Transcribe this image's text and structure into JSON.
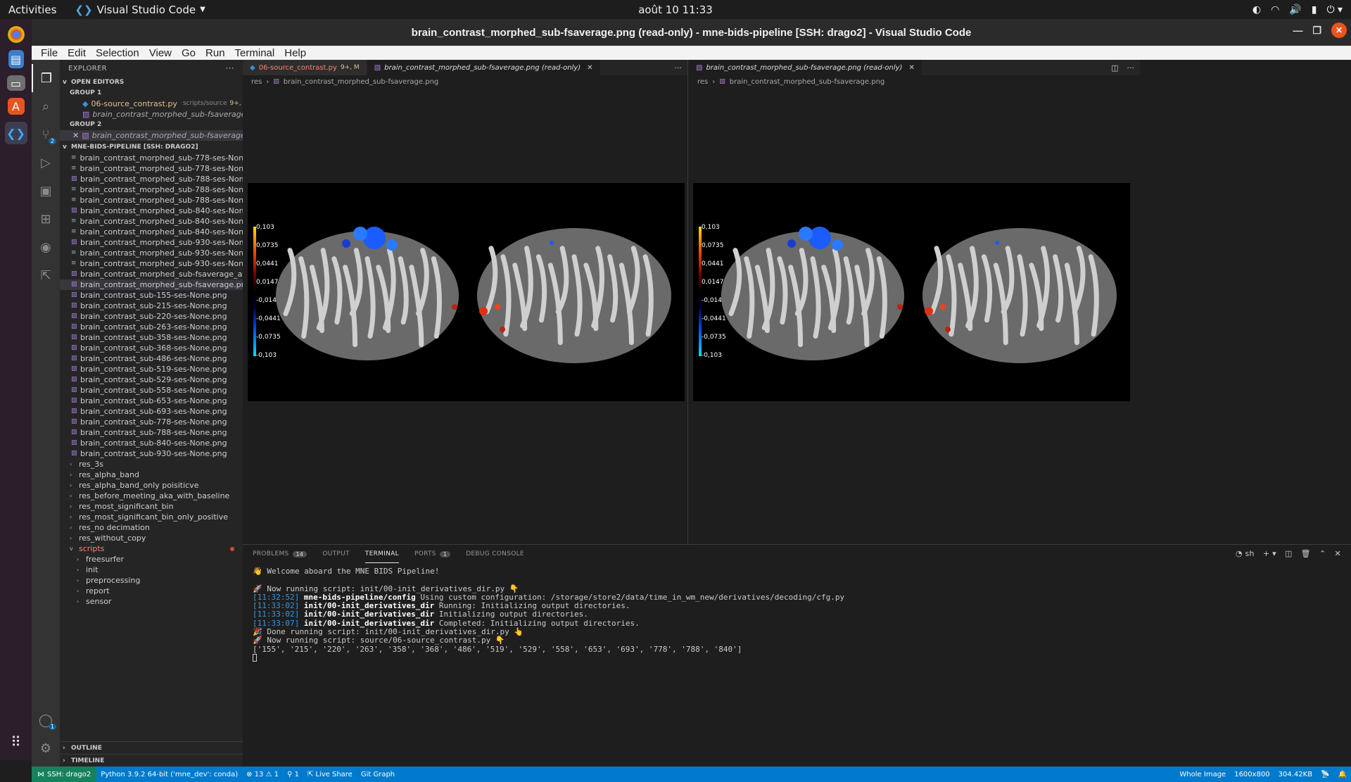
{
  "topbar": {
    "activities": "Activities",
    "app_name": "Visual Studio Code",
    "clock": "août 10  11:33"
  },
  "window": {
    "title": "brain_contrast_morphed_sub-fsaverage.png (read-only) - mne-bids-pipeline [SSH: drago2] - Visual Studio Code"
  },
  "menubar": [
    "File",
    "Edit",
    "Selection",
    "View",
    "Go",
    "Run",
    "Terminal",
    "Help"
  ],
  "activitybar": {
    "scm_badge": "2",
    "accounts_badge": "1"
  },
  "explorer": {
    "title": "EXPLORER",
    "open_editors_label": "OPEN EDITORS",
    "group1_label": "GROUP 1",
    "group1_items": [
      {
        "name": "06-source_contrast.py",
        "desc": "scripts/source",
        "flag": "9+, M"
      },
      {
        "name": "brain_contrast_morphed_sub-fsaverage.png (..."
      }
    ],
    "group2_label": "GROUP 2",
    "group2_items": [
      {
        "name": "brain_contrast_morphed_sub-fsaverage.png..."
      }
    ],
    "workspace_label": "MNE-BIDS-PIPELINE [SSH: DRAGO2]",
    "files": [
      {
        "name": "brain_contrast_morphed_sub-778-ses-None.stc-...",
        "type": "txt"
      },
      {
        "name": "brain_contrast_morphed_sub-778-ses-None.stc-...",
        "type": "txt"
      },
      {
        "name": "brain_contrast_morphed_sub-788-ses-None.png",
        "type": "img"
      },
      {
        "name": "brain_contrast_morphed_sub-788-ses-None.stc-...",
        "type": "txt"
      },
      {
        "name": "brain_contrast_morphed_sub-788-ses-None.stc-...",
        "type": "txt"
      },
      {
        "name": "brain_contrast_morphed_sub-840-ses-None.png",
        "type": "img"
      },
      {
        "name": "brain_contrast_morphed_sub-840-ses-None.stc-...",
        "type": "txt"
      },
      {
        "name": "brain_contrast_morphed_sub-840-ses-None.stc-...",
        "type": "txt"
      },
      {
        "name": "brain_contrast_morphed_sub-930-ses-None.png",
        "type": "img"
      },
      {
        "name": "brain_contrast_morphed_sub-930-ses-None.stc-...",
        "type": "txt"
      },
      {
        "name": "brain_contrast_morphed_sub-930-ses-None.stc-...",
        "type": "txt"
      },
      {
        "name": "brain_contrast_morphed_sub-fsaverage_all.png",
        "type": "img"
      },
      {
        "name": "brain_contrast_morphed_sub-fsaverage.png",
        "type": "img",
        "selected": true
      },
      {
        "name": "brain_contrast_sub-155-ses-None.png",
        "type": "img"
      },
      {
        "name": "brain_contrast_sub-215-ses-None.png",
        "type": "img"
      },
      {
        "name": "brain_contrast_sub-220-ses-None.png",
        "type": "img"
      },
      {
        "name": "brain_contrast_sub-263-ses-None.png",
        "type": "img"
      },
      {
        "name": "brain_contrast_sub-358-ses-None.png",
        "type": "img"
      },
      {
        "name": "brain_contrast_sub-368-ses-None.png",
        "type": "img"
      },
      {
        "name": "brain_contrast_sub-486-ses-None.png",
        "type": "img"
      },
      {
        "name": "brain_contrast_sub-519-ses-None.png",
        "type": "img"
      },
      {
        "name": "brain_contrast_sub-529-ses-None.png",
        "type": "img"
      },
      {
        "name": "brain_contrast_sub-558-ses-None.png",
        "type": "img"
      },
      {
        "name": "brain_contrast_sub-653-ses-None.png",
        "type": "img"
      },
      {
        "name": "brain_contrast_sub-693-ses-None.png",
        "type": "img"
      },
      {
        "name": "brain_contrast_sub-778-ses-None.png",
        "type": "img"
      },
      {
        "name": "brain_contrast_sub-788-ses-None.png",
        "type": "img"
      },
      {
        "name": "brain_contrast_sub-840-ses-None.png",
        "type": "img"
      },
      {
        "name": "brain_contrast_sub-930-ses-None.png",
        "type": "img"
      }
    ],
    "folders": [
      "res_3s",
      "res_alpha_band",
      "res_alpha_band_only poisiticve",
      "res_before_meeting_aka_with_baseline",
      "res_most_significant_bin",
      "res_most_significant_bin_only_positive",
      "res_no decimation",
      "res_without_copy"
    ],
    "scripts_folder": "scripts",
    "script_subfolders": [
      "freesurfer",
      "init",
      "preprocessing",
      "report",
      "sensor"
    ],
    "outline_label": "OUTLINE",
    "timeline_label": "TIMELINE"
  },
  "editor1": {
    "tab1": {
      "label": "06-source_contrast.py",
      "flag": "9+, M"
    },
    "tab2": {
      "label": "brain_contrast_morphed_sub-fsaverage.png (read-only)"
    },
    "crumbs": [
      "res",
      "brain_contrast_morphed_sub-fsaverage.png"
    ]
  },
  "editor2": {
    "tab1": {
      "label": "brain_contrast_morphed_sub-fsaverage.png (read-only)"
    },
    "crumbs": [
      "res",
      "brain_contrast_morphed_sub-fsaverage.png"
    ]
  },
  "colorbar_labels": [
    "0,103",
    "0,0735",
    "0,0441",
    "0,0147",
    "-0,0147",
    "-0,0441",
    "-0,0735",
    "-0,103"
  ],
  "panel": {
    "tabs": [
      {
        "label": "PROBLEMS",
        "badge": "14"
      },
      {
        "label": "OUTPUT"
      },
      {
        "label": "TERMINAL",
        "active": true
      },
      {
        "label": "PORTS",
        "badge": "1"
      },
      {
        "label": "DEBUG CONSOLE"
      }
    ],
    "shell": "sh"
  },
  "terminal": {
    "welcome": "👋 Welcome aboard the MNE BIDS Pipeline!",
    "run1": "🚀 Now running script: init/00-init_derivatives_dir.py 👇",
    "log": [
      {
        "ts": "[11:32:52]",
        "src": "mne-bids-pipeline/config",
        "msg": " Using custom configuration: /storage/store2/data/time_in_wm_new/derivatives/decoding/cfg.py"
      },
      {
        "ts": "[11:33:02]",
        "src": "init/00-init_derivatives_dir",
        "msg": " Running: Initializing output directories."
      },
      {
        "ts": "[11:33:02]",
        "src": "init/00-init_derivatives_dir",
        "msg": " Initializing output directories."
      },
      {
        "ts": "[11:33:07]",
        "src": "init/00-init_derivatives_dir",
        "msg": " Completed: Initializing output directories."
      }
    ],
    "done": "🎉 Done running script: init/00-init_derivatives_dir.py 👆",
    "run2": "🚀 Now running script: source/06-source_contrast.py 👇",
    "subjects": "['155', '215', '220', '263', '358', '368', '486', '519', '529', '558', '653', '693', '778', '788', '840']"
  },
  "statusbar": {
    "remote": "SSH: drago2",
    "python": "Python 3.9.2 64-bit ('mne_dev': conda)",
    "problems": "⊗ 13 ⚠ 1",
    "ports": "⚲ 1",
    "liveshare": "Live Share",
    "gitgraph": "Git Graph",
    "whole_image": "Whole Image",
    "dimensions": "1600x800",
    "filesize": "304.42KB"
  }
}
